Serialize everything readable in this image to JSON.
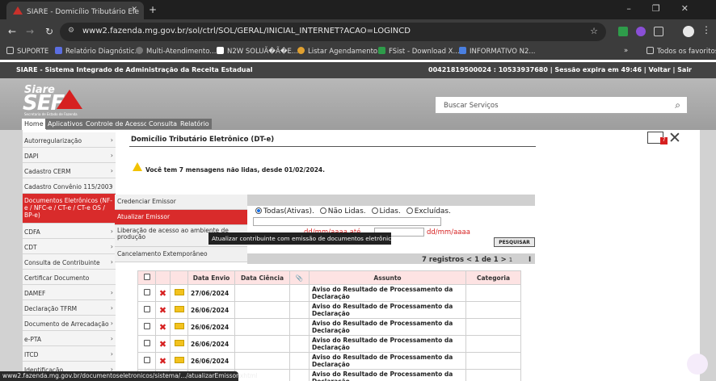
{
  "browser": {
    "tab_title": "SIARE - Domicílio Tributário Ele",
    "url": "www2.fazenda.mg.gov.br/sol/ctrl/SOL/GERAL/INICIAL_INTERNET?ACAO=LOGINCD",
    "bookmarks": [
      "SUPORTE",
      "Relatório Diagnóstic...",
      "Multi-Atendimento...",
      "N2W SOLUÃ�Ã�E...",
      "Listar Agendamento...",
      "FSist - Download X...",
      "INFORMATIVO N2..."
    ],
    "all_favorites": "Todos os favoritos",
    "status_url": "www2.fazenda.mg.gov.br/documentoseletronicos/sistema/.../atualizarEmissor.xhtml"
  },
  "siare": {
    "system_title": "SIARE - Sistema Integrado de Administração da Receita Estadual",
    "session_info": "00421819500024 : 10533937680 | Sessão expira em  49:46 | Voltar | Sair",
    "logo_top": "Siare",
    "logo_main": "SEF",
    "logo_sub": "Secretaria de Estado de Fazenda",
    "search_placeholder": "Buscar Serviços",
    "tabs": [
      "Home",
      "Aplicativos",
      "Controle de Acesso",
      "Consulta",
      "Relatório"
    ]
  },
  "sidebar": [
    "Autorregularização",
    "DAPI",
    "Cadastro CERM",
    "Cadastro Convênio 115/2003",
    "Documentos Eletrônicos (NF-e / NFC-e / CT-e / CT-e OS / BP-e)",
    "CDFA",
    "CDT",
    "Consulta de Contribuinte",
    "Certificar Documento",
    "DAMEF",
    "Declaração TFRM",
    "Documento de Arrecadação",
    "e-PTA",
    "ITCD",
    "Identificação"
  ],
  "submenu": [
    "Credenciar Emissor",
    "Atualizar Emissor",
    "Liberação de acesso ao ambiente de produção",
    "Cancelamento Extemporâneo"
  ],
  "tooltip": "Atualizar contribuinte com emissão de documentos eletrônicos.",
  "main": {
    "title": "Domicílio Tributário Eletrônico (DT-e)",
    "warning": "Você tem 7 mensagens não lidas, desde 01/02/2024.",
    "mail_count": "7",
    "radios": [
      "Todas(Ativas).",
      "Não Lidas.",
      "Lidas.",
      "Excluídas."
    ],
    "date_placeholder": "dd/mm/aaaa",
    "date_sep": "até",
    "search_button": "PESQUISAR",
    "pagination": "7 registros < 1 de 1 >",
    "page_num": "1",
    "page_i": "I"
  },
  "table": {
    "headers": [
      "Data Envio",
      "Data Ciência",
      "Assunto",
      "Categoria"
    ],
    "rows": [
      {
        "date": "27/06/2024",
        "subject": "Aviso do Resultado de Processamento da Declaração"
      },
      {
        "date": "26/06/2024",
        "subject": "Aviso do Resultado de Processamento da Declaração"
      },
      {
        "date": "26/06/2024",
        "subject": "Aviso do Resultado de Processamento da Declaração"
      },
      {
        "date": "26/06/2024",
        "subject": "Aviso do Resultado de Processamento da Declaração"
      },
      {
        "date": "26/06/2024",
        "subject": "Aviso do Resultado de Processamento da Declaração"
      },
      {
        "date": "",
        "subject": "Aviso do Resultado de Processamento da Declaração"
      }
    ]
  },
  "colors": {
    "accent_red": "#d92b2b",
    "header_gray": "#b0b0b0",
    "table_header": "#fde3e3"
  }
}
